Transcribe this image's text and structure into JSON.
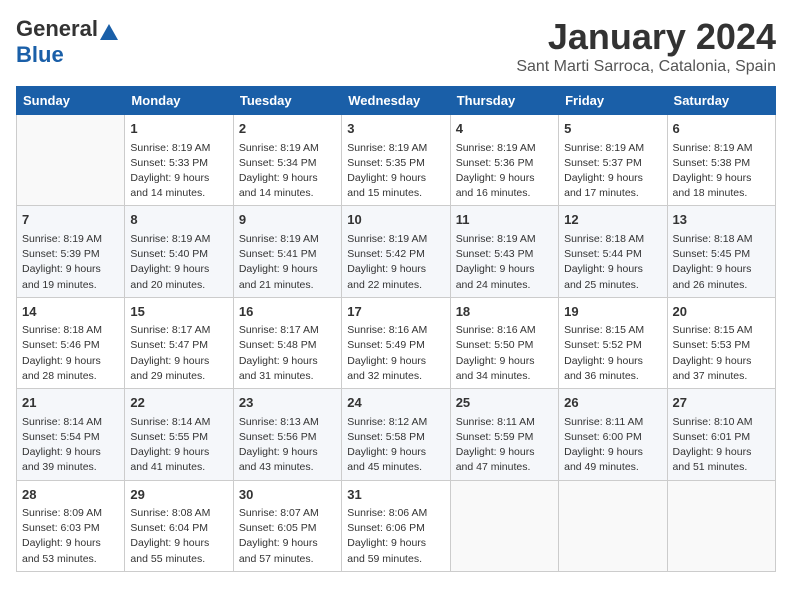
{
  "logo": {
    "general": "General",
    "blue": "Blue"
  },
  "title": "January 2024",
  "subtitle": "Sant Marti Sarroca, Catalonia, Spain",
  "columns": [
    "Sunday",
    "Monday",
    "Tuesday",
    "Wednesday",
    "Thursday",
    "Friday",
    "Saturday"
  ],
  "weeks": [
    [
      {
        "day": "",
        "text": ""
      },
      {
        "day": "1",
        "text": "Sunrise: 8:19 AM\nSunset: 5:33 PM\nDaylight: 9 hours\nand 14 minutes."
      },
      {
        "day": "2",
        "text": "Sunrise: 8:19 AM\nSunset: 5:34 PM\nDaylight: 9 hours\nand 14 minutes."
      },
      {
        "day": "3",
        "text": "Sunrise: 8:19 AM\nSunset: 5:35 PM\nDaylight: 9 hours\nand 15 minutes."
      },
      {
        "day": "4",
        "text": "Sunrise: 8:19 AM\nSunset: 5:36 PM\nDaylight: 9 hours\nand 16 minutes."
      },
      {
        "day": "5",
        "text": "Sunrise: 8:19 AM\nSunset: 5:37 PM\nDaylight: 9 hours\nand 17 minutes."
      },
      {
        "day": "6",
        "text": "Sunrise: 8:19 AM\nSunset: 5:38 PM\nDaylight: 9 hours\nand 18 minutes."
      }
    ],
    [
      {
        "day": "7",
        "text": "Sunrise: 8:19 AM\nSunset: 5:39 PM\nDaylight: 9 hours\nand 19 minutes."
      },
      {
        "day": "8",
        "text": "Sunrise: 8:19 AM\nSunset: 5:40 PM\nDaylight: 9 hours\nand 20 minutes."
      },
      {
        "day": "9",
        "text": "Sunrise: 8:19 AM\nSunset: 5:41 PM\nDaylight: 9 hours\nand 21 minutes."
      },
      {
        "day": "10",
        "text": "Sunrise: 8:19 AM\nSunset: 5:42 PM\nDaylight: 9 hours\nand 22 minutes."
      },
      {
        "day": "11",
        "text": "Sunrise: 8:19 AM\nSunset: 5:43 PM\nDaylight: 9 hours\nand 24 minutes."
      },
      {
        "day": "12",
        "text": "Sunrise: 8:18 AM\nSunset: 5:44 PM\nDaylight: 9 hours\nand 25 minutes."
      },
      {
        "day": "13",
        "text": "Sunrise: 8:18 AM\nSunset: 5:45 PM\nDaylight: 9 hours\nand 26 minutes."
      }
    ],
    [
      {
        "day": "14",
        "text": "Sunrise: 8:18 AM\nSunset: 5:46 PM\nDaylight: 9 hours\nand 28 minutes."
      },
      {
        "day": "15",
        "text": "Sunrise: 8:17 AM\nSunset: 5:47 PM\nDaylight: 9 hours\nand 29 minutes."
      },
      {
        "day": "16",
        "text": "Sunrise: 8:17 AM\nSunset: 5:48 PM\nDaylight: 9 hours\nand 31 minutes."
      },
      {
        "day": "17",
        "text": "Sunrise: 8:16 AM\nSunset: 5:49 PM\nDaylight: 9 hours\nand 32 minutes."
      },
      {
        "day": "18",
        "text": "Sunrise: 8:16 AM\nSunset: 5:50 PM\nDaylight: 9 hours\nand 34 minutes."
      },
      {
        "day": "19",
        "text": "Sunrise: 8:15 AM\nSunset: 5:52 PM\nDaylight: 9 hours\nand 36 minutes."
      },
      {
        "day": "20",
        "text": "Sunrise: 8:15 AM\nSunset: 5:53 PM\nDaylight: 9 hours\nand 37 minutes."
      }
    ],
    [
      {
        "day": "21",
        "text": "Sunrise: 8:14 AM\nSunset: 5:54 PM\nDaylight: 9 hours\nand 39 minutes."
      },
      {
        "day": "22",
        "text": "Sunrise: 8:14 AM\nSunset: 5:55 PM\nDaylight: 9 hours\nand 41 minutes."
      },
      {
        "day": "23",
        "text": "Sunrise: 8:13 AM\nSunset: 5:56 PM\nDaylight: 9 hours\nand 43 minutes."
      },
      {
        "day": "24",
        "text": "Sunrise: 8:12 AM\nSunset: 5:58 PM\nDaylight: 9 hours\nand 45 minutes."
      },
      {
        "day": "25",
        "text": "Sunrise: 8:11 AM\nSunset: 5:59 PM\nDaylight: 9 hours\nand 47 minutes."
      },
      {
        "day": "26",
        "text": "Sunrise: 8:11 AM\nSunset: 6:00 PM\nDaylight: 9 hours\nand 49 minutes."
      },
      {
        "day": "27",
        "text": "Sunrise: 8:10 AM\nSunset: 6:01 PM\nDaylight: 9 hours\nand 51 minutes."
      }
    ],
    [
      {
        "day": "28",
        "text": "Sunrise: 8:09 AM\nSunset: 6:03 PM\nDaylight: 9 hours\nand 53 minutes."
      },
      {
        "day": "29",
        "text": "Sunrise: 8:08 AM\nSunset: 6:04 PM\nDaylight: 9 hours\nand 55 minutes."
      },
      {
        "day": "30",
        "text": "Sunrise: 8:07 AM\nSunset: 6:05 PM\nDaylight: 9 hours\nand 57 minutes."
      },
      {
        "day": "31",
        "text": "Sunrise: 8:06 AM\nSunset: 6:06 PM\nDaylight: 9 hours\nand 59 minutes."
      },
      {
        "day": "",
        "text": ""
      },
      {
        "day": "",
        "text": ""
      },
      {
        "day": "",
        "text": ""
      }
    ]
  ]
}
